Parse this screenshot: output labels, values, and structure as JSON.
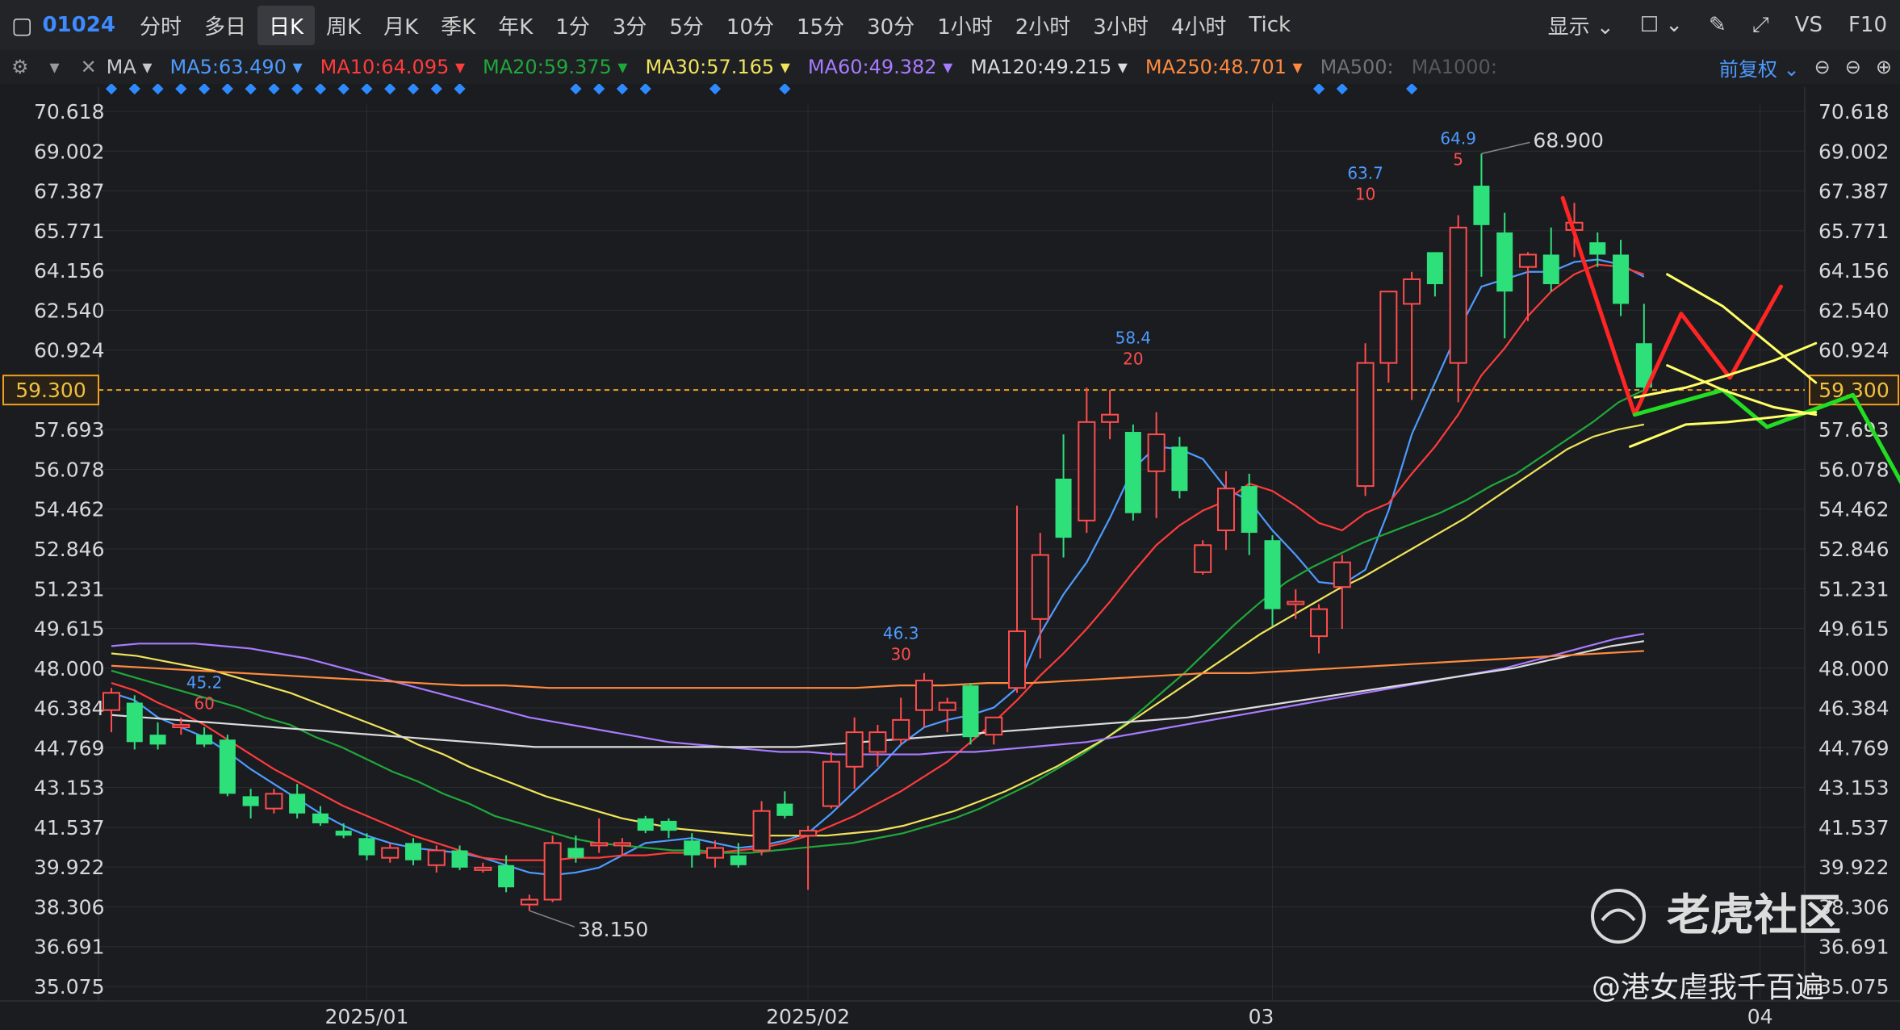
{
  "toolbar": {
    "code": "01024",
    "timeframes": [
      "分时",
      "多日",
      "日K",
      "周K",
      "月K",
      "季K",
      "年K",
      "1分",
      "3分",
      "5分",
      "10分",
      "15分",
      "30分",
      "1小时",
      "2小时",
      "3小时",
      "4小时",
      "Tick"
    ],
    "active": "日K",
    "display_label": "显示",
    "vs_label": "VS",
    "f10_label": "F10"
  },
  "ma_bar": {
    "indicator": "MA",
    "items": [
      {
        "label": "MA5:63.490",
        "color": "#4d9bff"
      },
      {
        "label": "MA10:64.095",
        "color": "#ff3b3b"
      },
      {
        "label": "MA20:59.375",
        "color": "#1fa83a"
      },
      {
        "label": "MA30:57.165",
        "color": "#f0e45a"
      },
      {
        "label": "MA60:49.382",
        "color": "#a77bff"
      },
      {
        "label": "MA120:49.215",
        "color": "#dcdcdc"
      },
      {
        "label": "MA250:48.701",
        "color": "#ff8a3d"
      },
      {
        "label": "MA500:",
        "color": "#6f7377"
      },
      {
        "label": "MA1000:",
        "color": "#55585c"
      }
    ],
    "adjust": "前复权"
  },
  "chart_data": {
    "type": "candlestick",
    "ylim": [
      35.075,
      71.8
    ],
    "y_ticks": [
      "70.618",
      "69.002",
      "67.387",
      "65.771",
      "64.156",
      "62.540",
      "60.924",
      "59.300",
      "57.693",
      "56.078",
      "54.462",
      "52.846",
      "51.231",
      "49.615",
      "48.000",
      "46.384",
      "44.769",
      "43.153",
      "41.537",
      "39.922",
      "38.306",
      "36.691",
      "35.075"
    ],
    "x_labels": [
      {
        "text": "2025/01",
        "index": 11
      },
      {
        "text": "2025/02",
        "index": 30
      },
      {
        "text": "03",
        "index": 50
      },
      {
        "text": "04",
        "index": 71
      }
    ],
    "current_price": "59.300",
    "candles": [
      {
        "o": 46.3,
        "h": 47.2,
        "l": 45.4,
        "c": 47.0
      },
      {
        "o": 46.6,
        "h": 46.9,
        "l": 44.7,
        "c": 45.0
      },
      {
        "o": 45.3,
        "h": 45.8,
        "l": 44.7,
        "c": 44.9
      },
      {
        "o": 45.6,
        "h": 46.0,
        "l": 45.3,
        "c": 45.7
      },
      {
        "o": 45.3,
        "h": 45.6,
        "l": 44.8,
        "c": 44.9
      },
      {
        "o": 45.1,
        "h": 45.3,
        "l": 42.8,
        "c": 42.9
      },
      {
        "o": 42.8,
        "h": 43.1,
        "l": 41.9,
        "c": 42.4
      },
      {
        "o": 42.3,
        "h": 43.1,
        "l": 42.1,
        "c": 42.9
      },
      {
        "o": 42.9,
        "h": 43.3,
        "l": 41.9,
        "c": 42.1
      },
      {
        "o": 42.1,
        "h": 42.4,
        "l": 41.6,
        "c": 41.7
      },
      {
        "o": 41.4,
        "h": 41.7,
        "l": 41.1,
        "c": 41.2
      },
      {
        "o": 41.1,
        "h": 41.3,
        "l": 40.2,
        "c": 40.4
      },
      {
        "o": 40.3,
        "h": 40.9,
        "l": 40.1,
        "c": 40.7
      },
      {
        "o": 40.9,
        "h": 41.1,
        "l": 40.0,
        "c": 40.2
      },
      {
        "o": 40.0,
        "h": 40.8,
        "l": 39.7,
        "c": 40.6
      },
      {
        "o": 40.6,
        "h": 40.8,
        "l": 39.8,
        "c": 39.9
      },
      {
        "o": 39.8,
        "h": 40.1,
        "l": 39.7,
        "c": 39.9
      },
      {
        "o": 40.0,
        "h": 40.4,
        "l": 38.9,
        "c": 39.1
      },
      {
        "o": 38.4,
        "h": 38.8,
        "l": 38.15,
        "c": 38.6
      },
      {
        "o": 38.6,
        "h": 41.2,
        "l": 38.5,
        "c": 40.9
      },
      {
        "o": 40.7,
        "h": 41.2,
        "l": 40.1,
        "c": 40.3
      },
      {
        "o": 40.8,
        "h": 41.9,
        "l": 40.5,
        "c": 40.9
      },
      {
        "o": 40.8,
        "h": 41.1,
        "l": 40.4,
        "c": 40.9
      },
      {
        "o": 41.9,
        "h": 42.0,
        "l": 41.3,
        "c": 41.4
      },
      {
        "o": 41.8,
        "h": 41.9,
        "l": 41.1,
        "c": 41.4
      },
      {
        "o": 41.0,
        "h": 41.3,
        "l": 39.9,
        "c": 40.4
      },
      {
        "o": 40.3,
        "h": 41.0,
        "l": 39.9,
        "c": 40.7
      },
      {
        "o": 40.4,
        "h": 40.9,
        "l": 39.9,
        "c": 40.0
      },
      {
        "o": 40.6,
        "h": 42.6,
        "l": 40.4,
        "c": 42.2
      },
      {
        "o": 42.5,
        "h": 43.0,
        "l": 41.9,
        "c": 42.0
      },
      {
        "o": 41.2,
        "h": 41.6,
        "l": 39.0,
        "c": 41.4
      },
      {
        "o": 42.4,
        "h": 44.6,
        "l": 42.3,
        "c": 44.2
      },
      {
        "o": 44.0,
        "h": 46.0,
        "l": 43.1,
        "c": 45.4
      },
      {
        "o": 44.6,
        "h": 45.7,
        "l": 44.0,
        "c": 45.4
      },
      {
        "o": 45.1,
        "h": 46.8,
        "l": 44.9,
        "c": 45.9
      },
      {
        "o": 46.3,
        "h": 47.8,
        "l": 45.6,
        "c": 47.5
      },
      {
        "o": 46.3,
        "h": 46.8,
        "l": 45.4,
        "c": 46.6
      },
      {
        "o": 47.3,
        "h": 47.4,
        "l": 44.9,
        "c": 45.2
      },
      {
        "o": 45.3,
        "h": 45.9,
        "l": 44.9,
        "c": 46.0
      },
      {
        "o": 47.2,
        "h": 54.6,
        "l": 47.0,
        "c": 49.5
      },
      {
        "o": 50.0,
        "h": 53.5,
        "l": 48.4,
        "c": 52.6
      },
      {
        "o": 55.7,
        "h": 57.5,
        "l": 52.5,
        "c": 53.3
      },
      {
        "o": 54.0,
        "h": 59.4,
        "l": 53.5,
        "c": 58.0
      },
      {
        "o": 58.0,
        "h": 59.3,
        "l": 57.3,
        "c": 58.3
      },
      {
        "o": 57.6,
        "h": 57.9,
        "l": 54.0,
        "c": 54.3
      },
      {
        "o": 56.0,
        "h": 58.4,
        "l": 54.1,
        "c": 57.5
      },
      {
        "o": 57.0,
        "h": 57.4,
        "l": 54.9,
        "c": 55.2
      },
      {
        "o": 51.9,
        "h": 53.2,
        "l": 51.8,
        "c": 53.0
      },
      {
        "o": 53.6,
        "h": 56.0,
        "l": 52.8,
        "c": 55.3
      },
      {
        "o": 55.4,
        "h": 55.9,
        "l": 52.6,
        "c": 53.5
      },
      {
        "o": 53.2,
        "h": 53.4,
        "l": 49.7,
        "c": 50.4
      },
      {
        "o": 50.6,
        "h": 51.2,
        "l": 50.0,
        "c": 50.7
      },
      {
        "o": 49.3,
        "h": 50.6,
        "l": 48.6,
        "c": 50.4
      },
      {
        "o": 51.3,
        "h": 52.6,
        "l": 49.6,
        "c": 52.3
      },
      {
        "o": 55.4,
        "h": 61.2,
        "l": 55.0,
        "c": 60.4
      },
      {
        "o": 60.4,
        "h": 61.9,
        "l": 59.6,
        "c": 63.3
      },
      {
        "o": 62.8,
        "h": 64.1,
        "l": 58.9,
        "c": 63.8
      },
      {
        "o": 64.9,
        "h": 64.2,
        "l": 63.1,
        "c": 63.6
      },
      {
        "o": 60.4,
        "h": 66.4,
        "l": 58.8,
        "c": 65.9
      },
      {
        "o": 67.6,
        "h": 68.9,
        "l": 63.9,
        "c": 66.0
      },
      {
        "o": 65.7,
        "h": 66.5,
        "l": 61.4,
        "c": 63.3
      },
      {
        "o": 64.3,
        "h": 64.9,
        "l": 62.1,
        "c": 64.8
      },
      {
        "o": 64.8,
        "h": 65.9,
        "l": 63.3,
        "c": 63.6
      },
      {
        "o": 65.8,
        "h": 66.9,
        "l": 64.7,
        "c": 66.1
      },
      {
        "o": 65.3,
        "h": 65.7,
        "l": 64.3,
        "c": 64.8
      },
      {
        "o": 64.8,
        "h": 65.4,
        "l": 62.3,
        "c": 62.8
      },
      {
        "o": 61.2,
        "h": 62.8,
        "l": 59.3,
        "c": 59.4
      }
    ],
    "ma_lines": [
      {
        "name": "MA5",
        "color": "#4d9bff",
        "values": [
          47.0,
          46.7,
          46.0,
          45.6,
          45.2,
          44.6,
          43.9,
          43.3,
          42.7,
          42.1,
          41.6,
          41.2,
          40.9,
          40.7,
          40.6,
          40.5,
          40.3,
          40.0,
          39.7,
          39.6,
          39.7,
          39.9,
          40.4,
          40.9,
          41.0,
          41.1,
          40.9,
          40.7,
          40.8,
          41.0,
          41.3,
          42.1,
          43.0,
          43.9,
          44.9,
          45.6,
          45.9,
          46.1,
          46.4,
          47.2,
          49.4,
          51.0,
          52.3,
          54.1,
          56.1,
          57.0,
          56.9,
          56.5,
          55.3,
          54.8,
          53.6,
          52.6,
          51.5,
          51.4,
          52.0,
          54.4,
          57.5,
          59.6,
          61.7,
          63.5,
          63.8,
          64.1,
          64.1,
          64.5,
          64.6,
          64.4,
          63.9
        ]
      },
      {
        "name": "MA10",
        "color": "#ff3b3b",
        "values": [
          47.4,
          47.1,
          46.6,
          46.2,
          45.7,
          45.1,
          44.5,
          43.9,
          43.4,
          42.9,
          42.4,
          42.0,
          41.6,
          41.2,
          40.9,
          40.6,
          40.3,
          40.2,
          40.2,
          40.2,
          40.3,
          40.3,
          40.4,
          40.4,
          40.5,
          40.5,
          40.5,
          40.6,
          40.7,
          40.9,
          41.2,
          41.6,
          42.0,
          42.5,
          43.0,
          43.6,
          44.2,
          45.0,
          45.8,
          46.7,
          47.7,
          48.6,
          49.6,
          50.7,
          51.9,
          53.0,
          53.8,
          54.4,
          54.8,
          55.5,
          55.2,
          54.6,
          53.9,
          53.6,
          54.3,
          54.7,
          55.9,
          57.0,
          58.3,
          59.9,
          61.0,
          62.3,
          63.3,
          64.0,
          64.4,
          64.3,
          64.0
        ]
      },
      {
        "name": "MA20",
        "color": "#1fa83a",
        "values": [
          47.9,
          47.6,
          47.3,
          47.0,
          46.7,
          46.4,
          46.0,
          45.7,
          45.2,
          44.8,
          44.3,
          43.8,
          43.4,
          42.9,
          42.5,
          42.0,
          41.7,
          41.4,
          41.1,
          40.9,
          40.8,
          40.7,
          40.6,
          40.6,
          40.5,
          40.5,
          40.6,
          40.7,
          40.8,
          40.9,
          41.1,
          41.3,
          41.6,
          41.9,
          42.3,
          42.8,
          43.3,
          43.9,
          44.5,
          45.2,
          46.0,
          46.9,
          47.8,
          48.8,
          49.8,
          50.7,
          51.5,
          52.1,
          52.6,
          53.1,
          53.5,
          53.9,
          54.3,
          54.8,
          55.4,
          55.9,
          56.6,
          57.3,
          58.0,
          58.8,
          59.3
        ]
      },
      {
        "name": "MA30",
        "color": "#f0e45a",
        "values": [
          48.6,
          48.5,
          48.3,
          48.1,
          47.9,
          47.6,
          47.3,
          47.0,
          46.6,
          46.2,
          45.8,
          45.4,
          44.9,
          44.5,
          44.0,
          43.6,
          43.2,
          42.8,
          42.5,
          42.2,
          41.9,
          41.7,
          41.5,
          41.4,
          41.3,
          41.2,
          41.2,
          41.2,
          41.2,
          41.3,
          41.4,
          41.6,
          41.9,
          42.2,
          42.6,
          43.0,
          43.5,
          44.0,
          44.6,
          45.2,
          45.9,
          46.6,
          47.3,
          48.0,
          48.7,
          49.4,
          50.0,
          50.6,
          51.2,
          51.7,
          52.3,
          52.9,
          53.5,
          54.1,
          54.8,
          55.5,
          56.2,
          56.9,
          57.4,
          57.7,
          57.9
        ]
      },
      {
        "name": "MA60",
        "color": "#a77bff",
        "values": [
          48.9,
          49.0,
          49.0,
          49.0,
          48.9,
          48.8,
          48.6,
          48.4,
          48.1,
          47.8,
          47.5,
          47.2,
          46.9,
          46.6,
          46.3,
          46.0,
          45.8,
          45.6,
          45.4,
          45.2,
          45.0,
          44.9,
          44.8,
          44.7,
          44.6,
          44.6,
          44.5,
          44.5,
          44.5,
          44.5,
          44.6,
          44.6,
          44.7,
          44.8,
          44.9,
          45.0,
          45.2,
          45.4,
          45.6,
          45.8,
          46.0,
          46.2,
          46.4,
          46.6,
          46.8,
          47.0,
          47.2,
          47.4,
          47.6,
          47.8,
          48.0,
          48.3,
          48.6,
          48.9,
          49.2,
          49.4
        ]
      },
      {
        "name": "MA120",
        "color": "#dcdcdc",
        "values": [
          46.1,
          46.0,
          45.9,
          45.8,
          45.7,
          45.6,
          45.5,
          45.4,
          45.3,
          45.2,
          45.1,
          45.0,
          44.9,
          44.8,
          44.8,
          44.8,
          44.8,
          44.8,
          44.8,
          44.8,
          44.8,
          44.8,
          44.9,
          45.0,
          45.1,
          45.2,
          45.3,
          45.4,
          45.5,
          45.6,
          45.7,
          45.8,
          45.9,
          46.0,
          46.2,
          46.4,
          46.6,
          46.8,
          47.0,
          47.2,
          47.4,
          47.6,
          47.8,
          48.0,
          48.3,
          48.6,
          48.9,
          49.1
        ]
      },
      {
        "name": "MA250",
        "color": "#ff8a3d",
        "values": [
          48.1,
          48.0,
          47.9,
          47.8,
          47.7,
          47.6,
          47.5,
          47.4,
          47.3,
          47.3,
          47.2,
          47.2,
          47.2,
          47.2,
          47.2,
          47.2,
          47.2,
          47.2,
          47.3,
          47.3,
          47.4,
          47.4,
          47.5,
          47.6,
          47.7,
          47.8,
          47.8,
          47.9,
          48.0,
          48.1,
          48.2,
          48.3,
          48.4,
          48.5,
          48.6,
          48.7
        ]
      }
    ],
    "annotations": [
      {
        "text": "68.900",
        "i": 59,
        "v": 68.9,
        "kind": "high"
      },
      {
        "text": "38.150",
        "i": 18,
        "v": 38.15,
        "kind": "low"
      },
      {
        "value": "45.2",
        "days": "60",
        "i": 4,
        "v": 46.2
      },
      {
        "value": "46.3",
        "days": "30",
        "i": 34,
        "v": 48.2
      },
      {
        "value": "58.4",
        "days": "20",
        "i": 44,
        "v": 60.2
      },
      {
        "value": "63.7",
        "days": "10",
        "i": 54,
        "v": 66.9
      },
      {
        "value": "64.9",
        "days": "5",
        "i": 58,
        "v": 68.3
      }
    ],
    "drawings": [
      {
        "color": "#ff2525",
        "points": [
          [
            62.5,
            67.1
          ],
          [
            65.6,
            58.3
          ],
          [
            67.6,
            62.4
          ],
          [
            69.7,
            59.8
          ],
          [
            71.9,
            63.5
          ]
        ]
      },
      {
        "color": "#22dd22",
        "points": [
          [
            65.6,
            58.3
          ],
          [
            69.4,
            59.3
          ],
          [
            71.3,
            57.8
          ],
          [
            75.0,
            59.1
          ],
          [
            77.4,
            55.0
          ]
        ]
      },
      {
        "color": "#ffff66",
        "points": [
          [
            65.6,
            59.0
          ],
          [
            67.8,
            59.4
          ],
          [
            69.6,
            59.9
          ],
          [
            71.6,
            60.5
          ],
          [
            73.4,
            61.2
          ]
        ]
      },
      {
        "color": "#ffff66",
        "points": [
          [
            65.4,
            57.0
          ],
          [
            67.8,
            57.9
          ],
          [
            69.6,
            58.0
          ],
          [
            71.6,
            58.2
          ],
          [
            73.4,
            58.4
          ]
        ]
      },
      {
        "color": "#ffff66",
        "points": [
          [
            67.0,
            64.0
          ],
          [
            69.4,
            62.7
          ],
          [
            71.6,
            61.0
          ],
          [
            73.4,
            59.6
          ]
        ]
      },
      {
        "color": "#ffff66",
        "points": [
          [
            67.0,
            60.3
          ],
          [
            69.4,
            59.3
          ],
          [
            71.6,
            58.6
          ],
          [
            73.4,
            58.3
          ]
        ]
      }
    ],
    "diamond_rows": [
      {
        "from": 0,
        "to": 15
      },
      {
        "from": 20,
        "to": 23
      },
      {
        "from": 26,
        "to": 26
      },
      {
        "from": 29,
        "to": 29
      },
      {
        "from": 52,
        "to": 53
      },
      {
        "from": 56,
        "to": 56
      }
    ],
    "watermark": {
      "brand": "老虎社区",
      "author": "@港女虐我千百遍"
    }
  }
}
